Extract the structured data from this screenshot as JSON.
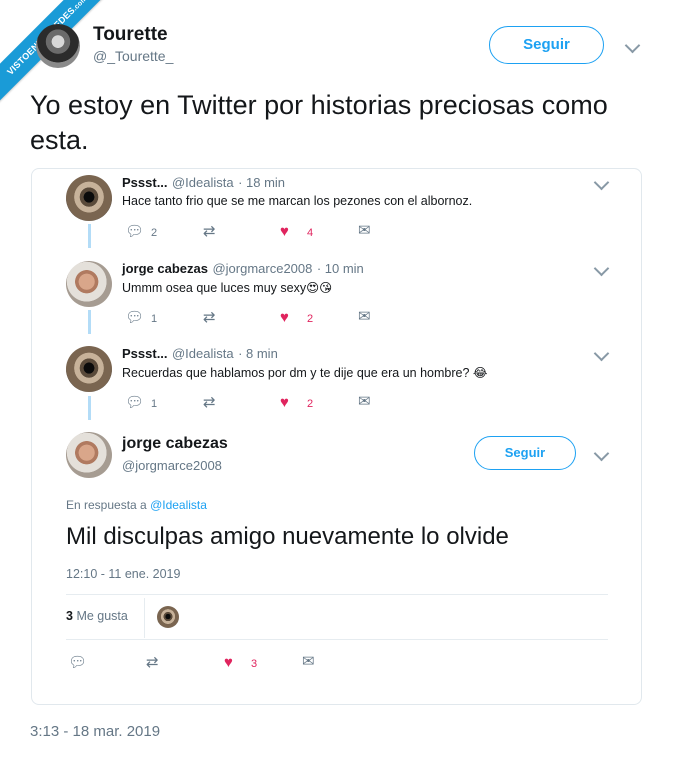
{
  "watermark": {
    "line1": "VISTOENLASREDES",
    "line2": ".com"
  },
  "tweet": {
    "author_name": "Tourette",
    "author_handle": "@_Tourette_",
    "follow_label": "Seguir",
    "text": "Yo estoy en Twitter por historias preciosas como esta.",
    "timestamp": "3:13 - 18 mar. 2019"
  },
  "quoted": {
    "replies": [
      {
        "name": "Pssst...",
        "handle": "@Idealista",
        "time": "· 18 min",
        "text": "Hace tanto frio que se me marcan los pezones con el albornoz.",
        "reply_count": "2",
        "like_count": "4"
      },
      {
        "name": "jorge cabezas",
        "handle": "@jorgmarce2008",
        "time": "· 10 min",
        "text": "Ummm osea que luces muy sexy",
        "emoji": "😍😘",
        "reply_count": "1",
        "like_count": "2"
      },
      {
        "name": "Pssst...",
        "handle": "@Idealista",
        "time": "· 8 min",
        "text": "Recuerdas que hablamos por dm y te dije que era un hombre?",
        "emoji": "😂",
        "reply_count": "1",
        "like_count": "2"
      }
    ],
    "main": {
      "name": "jorge cabezas",
      "handle": "@jorgmarce2008",
      "follow_label": "Seguir",
      "in_reply_prefix": "En respuesta a",
      "in_reply_handle": "@Idealista",
      "text": "Mil disculpas amigo nuevamente lo olvide",
      "timestamp": "12:10 - 11 ene. 2019",
      "likes_count": "3",
      "likes_label": "Me gusta",
      "like_count": "3"
    }
  },
  "colors": {
    "accent": "#1da1f2",
    "like": "#e0245e",
    "muted": "#657786",
    "watermark": "#1a9bd7"
  },
  "icons": [
    "reply-icon",
    "retweet-icon",
    "heart-icon",
    "dm-icon",
    "chevron-down-icon"
  ]
}
